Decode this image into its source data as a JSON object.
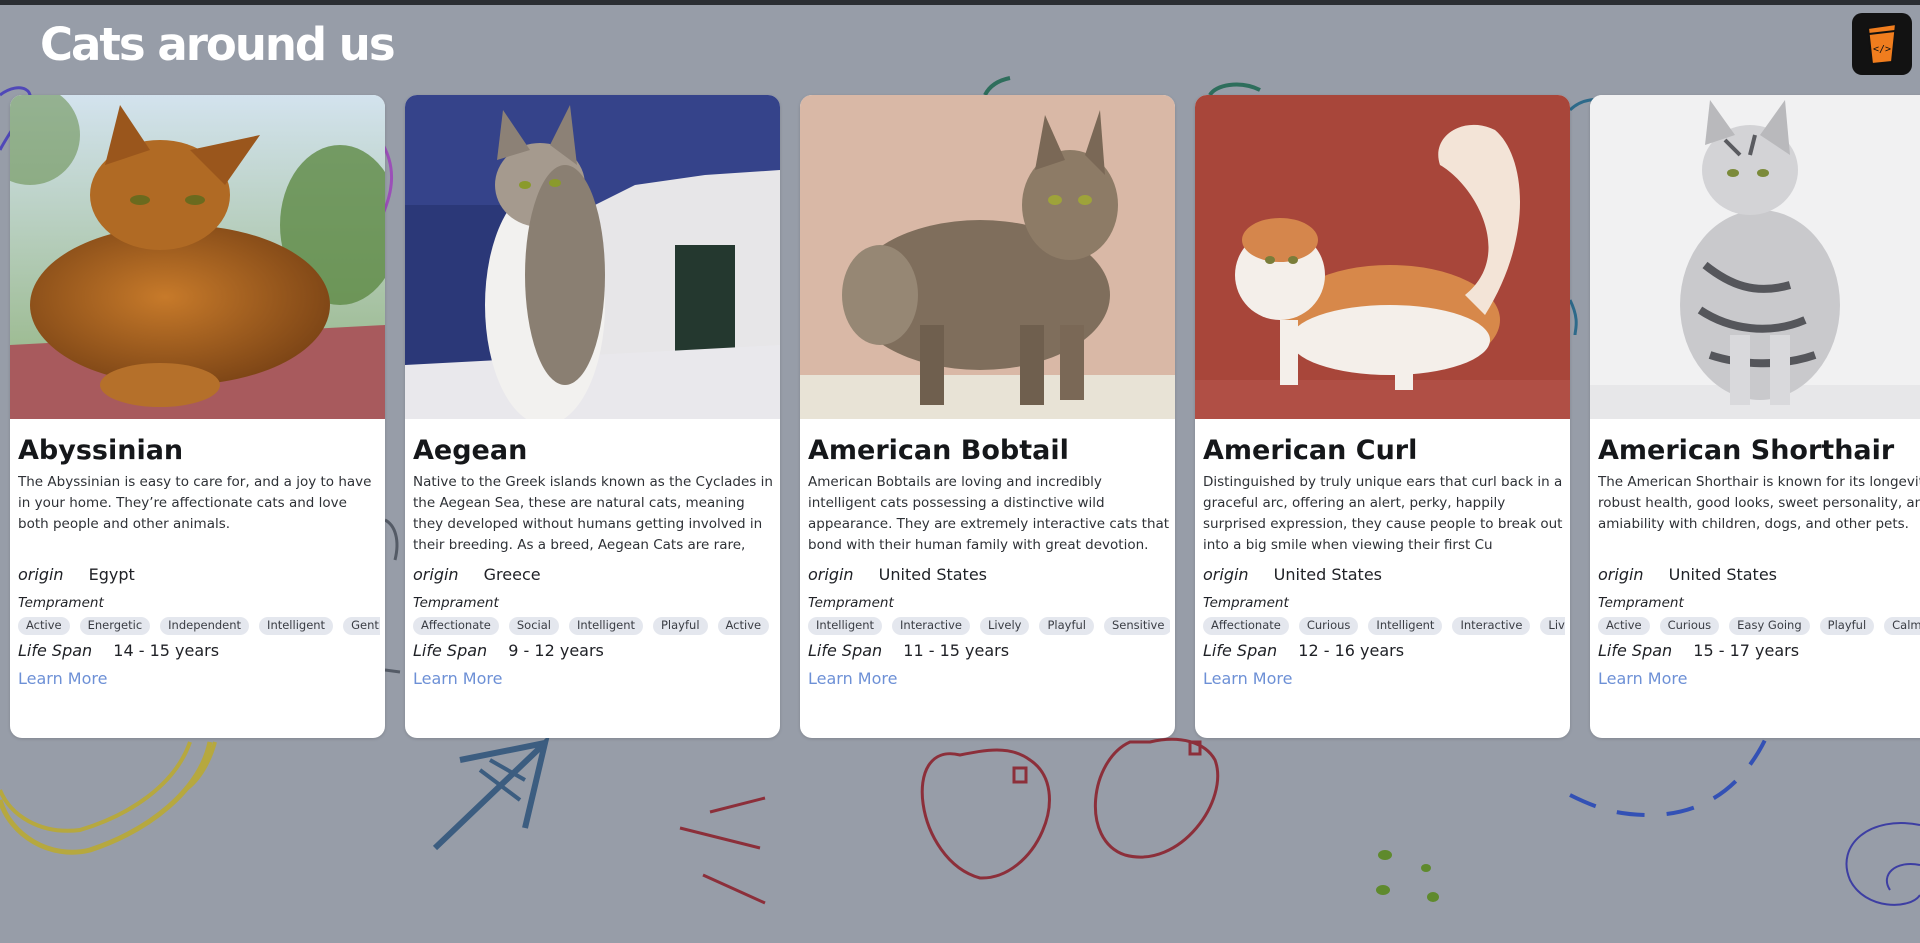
{
  "page": {
    "title": "Cats around us"
  },
  "logo": {
    "icon": "code-cup-icon",
    "text": "</>",
    "accent": "#f07d1e"
  },
  "colors": {
    "background": "#979da8",
    "link": "#6d90d6",
    "chip": "#e4e7ee"
  },
  "labels": {
    "origin": "origin",
    "temperament": "Temprament",
    "life_span": "Life Span",
    "learn_more": "Learn More"
  },
  "breeds": [
    {
      "name": "Abyssinian",
      "description": "The Abyssinian is easy to care for, and a joy to have in your home. They’re affectionate cats and love both people and other animals.",
      "origin": "Egypt",
      "temperament": [
        "Active",
        "Energetic",
        "Independent",
        "Intelligent",
        "Gentle"
      ],
      "life_span": "14 - 15 years"
    },
    {
      "name": "Aegean",
      "description": "Native to the Greek islands known as the Cyclades in the Aegean Sea, these are natural cats, meaning they developed without humans getting involved in their breeding. As a breed, Aegean Cats are rare,",
      "origin": "Greece",
      "temperament": [
        "Affectionate",
        "Social",
        "Intelligent",
        "Playful",
        "Active"
      ],
      "life_span": "9 - 12 years"
    },
    {
      "name": "American Bobtail",
      "description": "American Bobtails are loving and incredibly intelligent cats possessing a distinctive wild appearance. They are extremely interactive cats that bond with their human family with great devotion.",
      "origin": "United States",
      "temperament": [
        "Intelligent",
        "Interactive",
        "Lively",
        "Playful",
        "Sensitive"
      ],
      "life_span": "11 - 15 years"
    },
    {
      "name": "American Curl",
      "description": "Distinguished by truly unique ears that curl back in a graceful arc, offering an alert, perky, happily surprised expression, they cause people to break out into a big smile when viewing their first Cu",
      "origin": "United States",
      "temperament": [
        "Affectionate",
        "Curious",
        "Intelligent",
        "Interactive",
        "Lively"
      ],
      "life_span": "12 - 16 years"
    },
    {
      "name": "American Shorthair",
      "description": "The American Shorthair is known for its longevity, robust health, good looks, sweet personality, and amiability with children, dogs, and other pets.",
      "origin": "United States",
      "temperament": [
        "Active",
        "Curious",
        "Easy Going",
        "Playful",
        "Calm"
      ],
      "life_span": "15 - 17 years"
    }
  ]
}
